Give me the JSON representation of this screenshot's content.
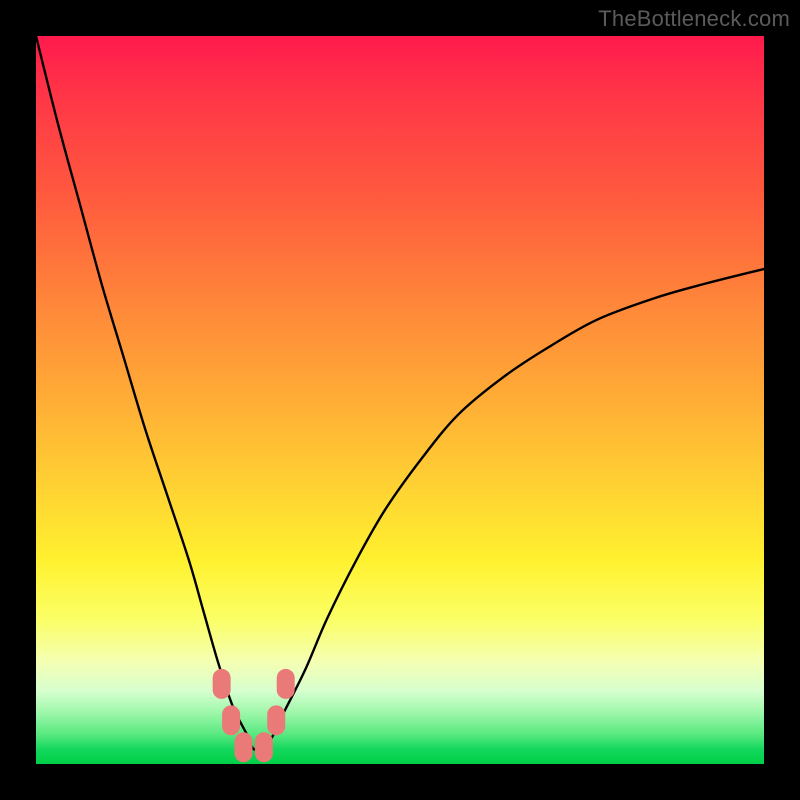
{
  "watermark": "TheBottleneck.com",
  "chart_data": {
    "type": "line",
    "title": "",
    "xlabel": "",
    "ylabel": "",
    "xlim": [
      0,
      100
    ],
    "ylim": [
      0,
      100
    ],
    "grid": false,
    "legend": false,
    "series": [
      {
        "name": "bottleneck-curve",
        "x": [
          0,
          3,
          6,
          9,
          12,
          15,
          18,
          21,
          23,
          25,
          27,
          29,
          30,
          32,
          34,
          37,
          40,
          44,
          48,
          53,
          58,
          64,
          70,
          77,
          85,
          92,
          100
        ],
        "y": [
          100,
          88,
          77,
          66,
          56,
          46,
          37,
          28,
          21,
          14,
          8,
          4,
          2,
          3,
          7,
          13,
          20,
          28,
          35,
          42,
          48,
          53,
          57,
          61,
          64,
          66,
          68
        ]
      }
    ],
    "markers": [
      {
        "name": "left-upper",
        "x": 25.5,
        "y": 11
      },
      {
        "name": "left-lower",
        "x": 26.8,
        "y": 6
      },
      {
        "name": "bottom-left",
        "x": 28.5,
        "y": 2.3
      },
      {
        "name": "bottom-right",
        "x": 31.3,
        "y": 2.3
      },
      {
        "name": "right-lower",
        "x": 33.0,
        "y": 6
      },
      {
        "name": "right-upper",
        "x": 34.3,
        "y": 11
      }
    ],
    "gradient_description": "vertical heat gradient: red (top) → orange → yellow → green (bottom)"
  }
}
